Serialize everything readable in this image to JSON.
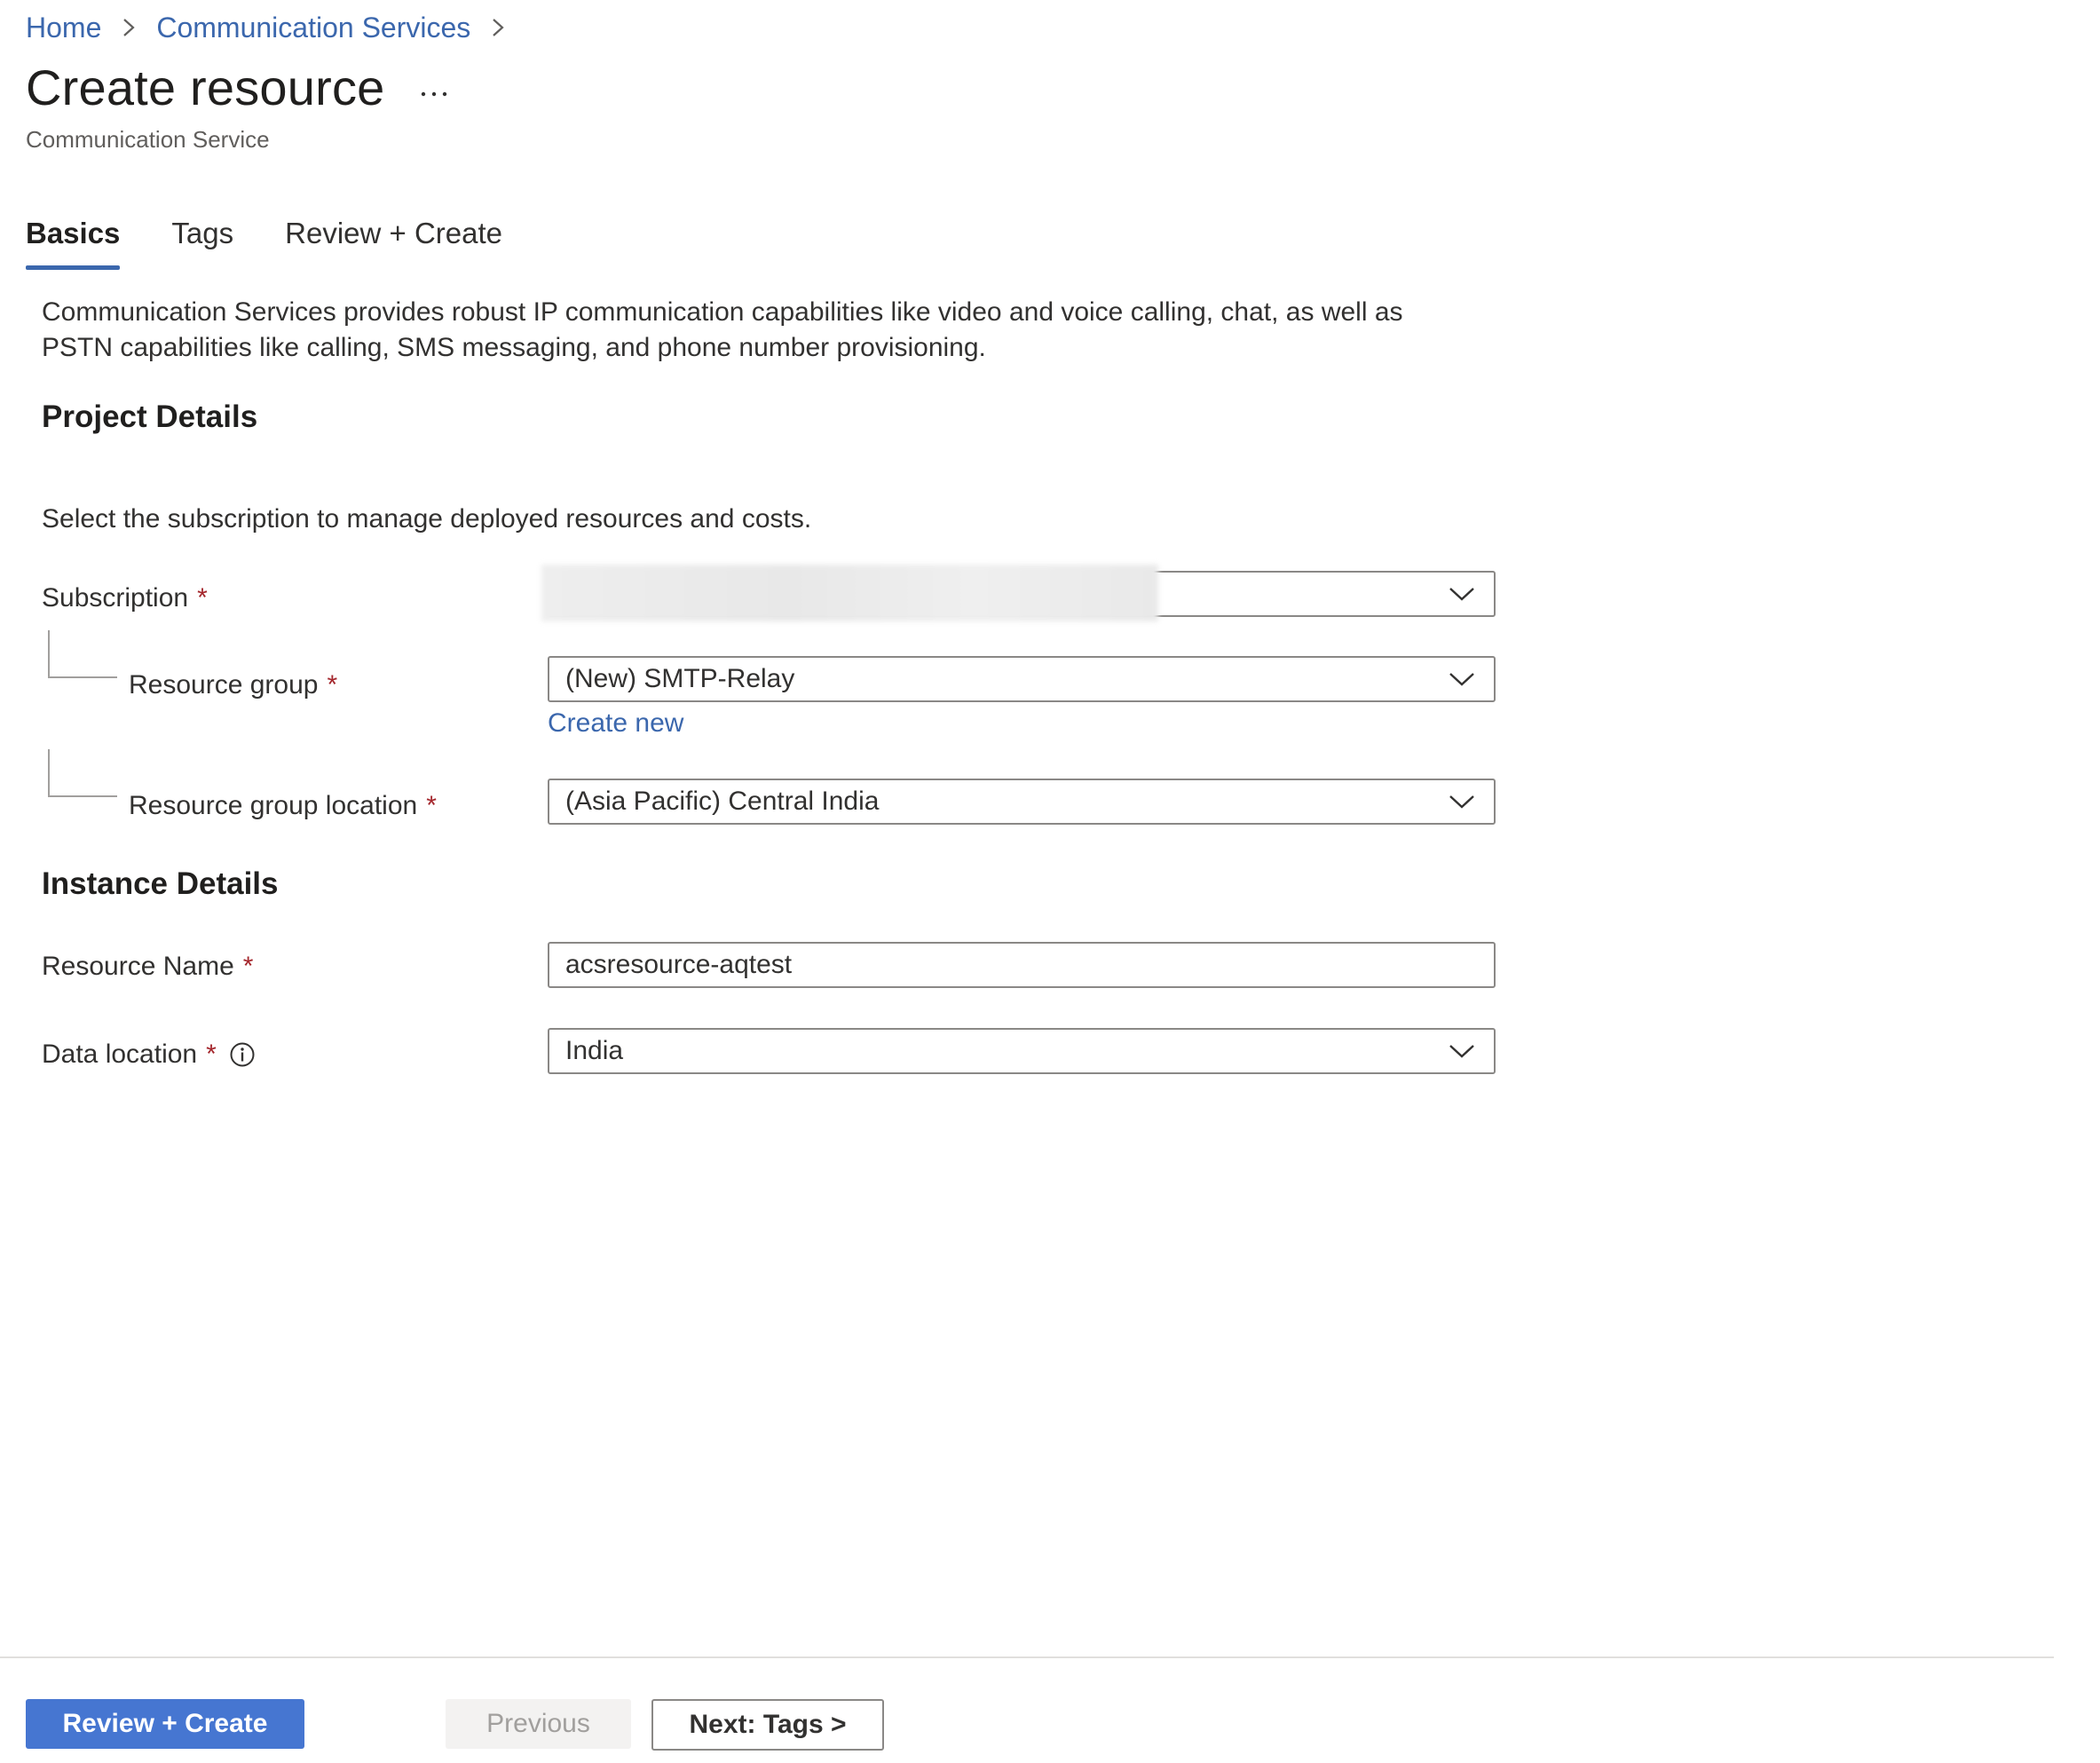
{
  "breadcrumb": {
    "items": [
      "Home",
      "Communication Services"
    ]
  },
  "header": {
    "title": "Create resource",
    "subtitle": "Communication Service",
    "more_label": "..."
  },
  "tabs": [
    {
      "label": "Basics",
      "active": true
    },
    {
      "label": "Tags",
      "active": false
    },
    {
      "label": "Review + Create",
      "active": false
    }
  ],
  "description": "Communication Services provides robust IP communication capabilities like video and voice calling, chat, as well as PSTN capabilities like calling, SMS messaging, and phone number provisioning.",
  "project_details": {
    "heading": "Project Details",
    "helper": "Select the subscription to manage deployed resources and costs.",
    "subscription": {
      "label": "Subscription",
      "required_mark": "*",
      "value": ""
    },
    "resource_group": {
      "label": "Resource group",
      "required_mark": "*",
      "value": "(New) SMTP-Relay",
      "create_new": "Create new"
    },
    "resource_group_location": {
      "label": "Resource group location",
      "required_mark": "*",
      "value": "(Asia Pacific) Central India"
    }
  },
  "instance_details": {
    "heading": "Instance Details",
    "resource_name": {
      "label": "Resource Name",
      "required_mark": "*",
      "value": "acsresource-aqtest"
    },
    "data_location": {
      "label": "Data location",
      "required_mark": "*",
      "value": "India"
    }
  },
  "footer": {
    "review_create": "Review + Create",
    "previous": "Previous",
    "next": "Next: Tags >"
  },
  "colors": {
    "accent": "#4676d1",
    "link": "#3b67ad",
    "required": "#a4262c"
  },
  "icons": [
    "chevron-right-icon",
    "more-icon",
    "chevron-down-icon",
    "info-icon"
  ]
}
